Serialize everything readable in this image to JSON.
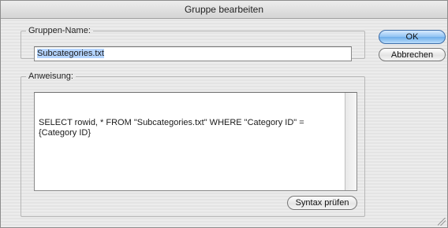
{
  "window": {
    "title": "Gruppe bearbeiten"
  },
  "group_name": {
    "legend": "Gruppen-Name:",
    "value": "Subcategories.txt"
  },
  "statement": {
    "legend": "Anweisung:",
    "value": "SELECT rowid, * FROM \"Subcategories.txt\" WHERE \"Category ID\" = {Category ID}"
  },
  "buttons": {
    "ok": "OK",
    "cancel": "Abbrechen",
    "syntax_check": "Syntax prüfen"
  },
  "colors": {
    "selection": "#b5d5ff",
    "default_button": "#6eaeea"
  }
}
